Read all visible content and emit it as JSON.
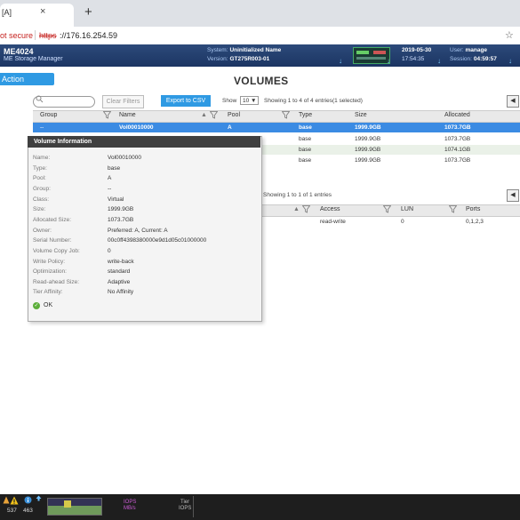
{
  "browser": {
    "tab_title": "[A]",
    "close_glyph": "×",
    "new_tab_glyph": "+",
    "not_secure": "ot secure",
    "url_scheme": "https",
    "url_rest": "://176.16.254.59",
    "star_glyph": "☆"
  },
  "header": {
    "model": "ME4024",
    "product": "ME Storage Manager",
    "system_label": "System:",
    "system_value": "Uninitialized Name",
    "version_label": "Version:",
    "version_value": "GT275R003-01",
    "date": "2019-05-30",
    "time": "17:54:35",
    "user_label": "User:",
    "user_value": "manage",
    "session_label": "Session:",
    "session_value": "04:59:57",
    "arrow_glyph": "↓"
  },
  "action_label": "Action",
  "page_title": "VOLUMES",
  "toolbar": {
    "clear_filters": "Clear Filters",
    "export_csv": "Export to CSV",
    "show_label": "Show",
    "show_value": "10 ▼",
    "entries": "Showing 1 to 4 of 4 entries(1 selected)",
    "collapse_glyph": "◀"
  },
  "volumes_table": {
    "columns": [
      "Group",
      "Name",
      "Pool",
      "Type",
      "Size",
      "Allocated"
    ],
    "rows": [
      [
        "--",
        "Vol00010000",
        "A",
        "base",
        "1999.9GB",
        "1073.7GB"
      ],
      [
        "",
        "",
        "",
        "base",
        "1999.9GB",
        "1073.7GB"
      ],
      [
        "",
        "",
        "",
        "base",
        "1999.9GB",
        "1074.1GB"
      ],
      [
        "",
        "",
        "",
        "base",
        "1999.9GB",
        "1073.7GB"
      ]
    ]
  },
  "popup": {
    "title": "Volume Information",
    "fields": [
      {
        "label": "Name:",
        "value": "Vol00010000"
      },
      {
        "label": "Type:",
        "value": "base"
      },
      {
        "label": "Pool:",
        "value": "A"
      },
      {
        "label": "Group:",
        "value": "--"
      },
      {
        "label": "Class:",
        "value": "Virtual"
      },
      {
        "label": "Size:",
        "value": "1999.9GB"
      },
      {
        "label": "Allocated Size:",
        "value": "1073.7GB"
      },
      {
        "label": "Owner:",
        "value": "Preferred: A, Current: A"
      },
      {
        "label": "Serial Number:",
        "value": "00c0ff4398380000e9d1d05c01000000"
      },
      {
        "label": "Volume Copy Job:",
        "value": "0"
      },
      {
        "label": "Write Policy:",
        "value": "write-back"
      },
      {
        "label": "Optimization:",
        "value": "standard"
      },
      {
        "label": "Read-ahead Size:",
        "value": "Adaptive"
      },
      {
        "label": "Tier Affinity:",
        "value": "No Affinity"
      }
    ],
    "status": "OK",
    "status_glyph": "✓"
  },
  "mappings": {
    "entries": "Showing 1 to 1 of 1 entries",
    "columns": [
      "Access",
      "LUN",
      "Ports"
    ],
    "rows": [
      [
        "read-write",
        "0",
        "0,1,2,3"
      ]
    ]
  },
  "footer": {
    "count1": "537",
    "count2": "463",
    "iops": "IOPS",
    "mbs": "MB/s",
    "tier": "Tier",
    "tier_iops": "IOPS"
  },
  "colors": {
    "accent": "#2f9ae3",
    "selected_row": "#3b8be3",
    "header_bg": "#1c3563",
    "zebra": "#eaf1e8"
  }
}
